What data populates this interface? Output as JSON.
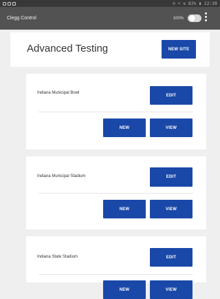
{
  "status_bar": {
    "text": "⊘ ☀ ⇅ 82% ▮ 12:39"
  },
  "app_bar": {
    "title": "Clegg Control",
    "zoom": "100%"
  },
  "header": {
    "title": "Advanced Testing",
    "new_site_label": "NEW SITE"
  },
  "sites": [
    {
      "name": "Indiana Municipal Bowl",
      "edit_label": "EDIT",
      "new_label": "NEW",
      "view_label": "VIEW"
    },
    {
      "name": "Indiana Municipal Stadium",
      "edit_label": "EDIT",
      "new_label": "NEW",
      "view_label": "VIEW"
    },
    {
      "name": "Indiana State Stadium",
      "edit_label": "EDIT",
      "new_label": "NEW",
      "view_label": "VIEW"
    }
  ]
}
